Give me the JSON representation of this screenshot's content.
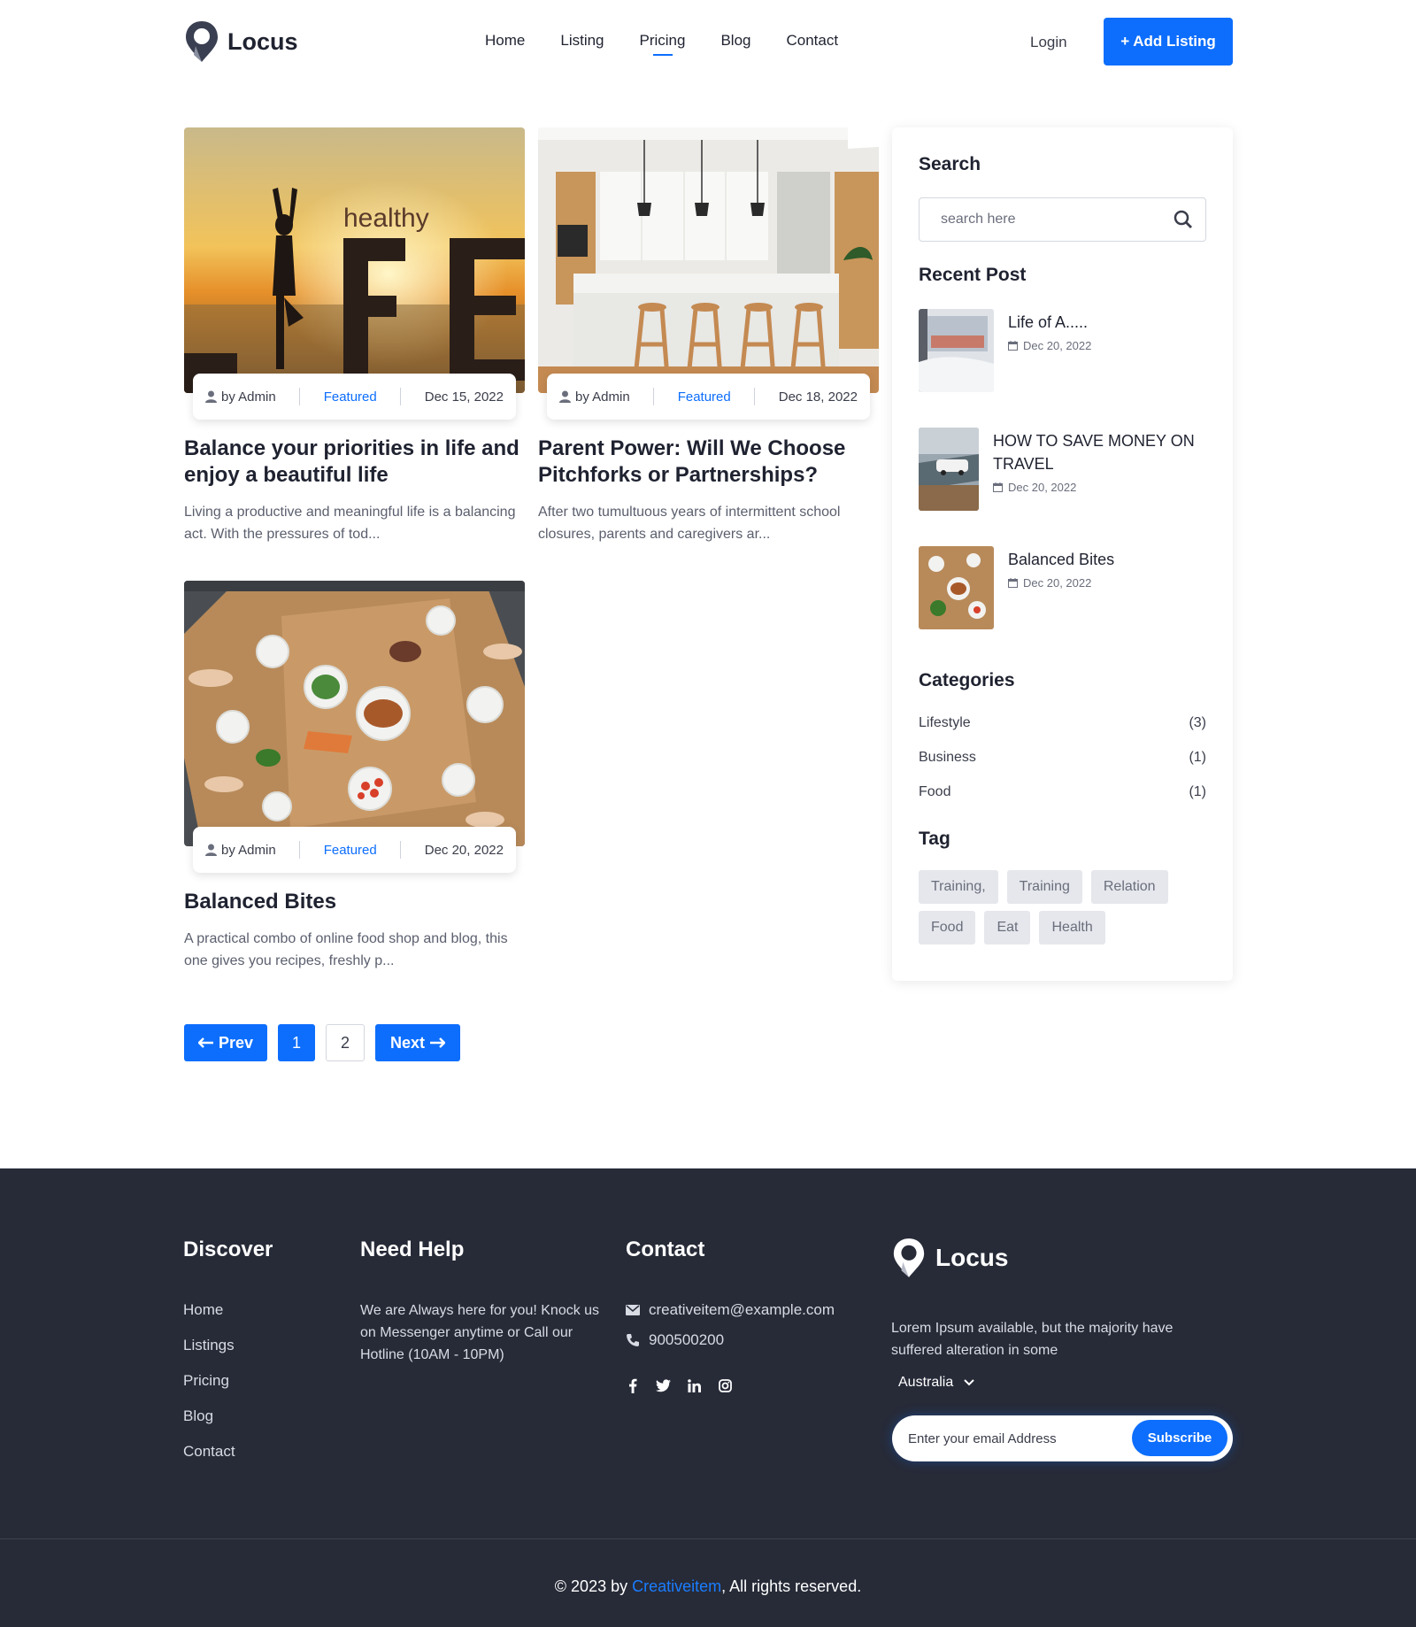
{
  "header": {
    "logo_text": "Locus",
    "nav": [
      {
        "label": "Home",
        "active": false
      },
      {
        "label": "Listing",
        "active": false
      },
      {
        "label": "Pricing",
        "active": true
      },
      {
        "label": "Blog",
        "active": false
      },
      {
        "label": "Contact",
        "active": false
      }
    ],
    "login_label": "Login",
    "add_listing_label": "+ Add Listing",
    "accent_color": "#0d6efd"
  },
  "posts": [
    {
      "author": "by Admin",
      "category": "Featured",
      "date": "Dec 15, 2022",
      "title": "Balance your priorities in life and enjoy a beautiful life",
      "excerpt": "Living a productive and meaningful life is a balancing act. With the pressures of tod...",
      "image_text": "healthy"
    },
    {
      "author": "by Admin",
      "category": "Featured",
      "date": "Dec 18, 2022",
      "title": "Parent Power: Will We Choose Pitchforks or Partnerships?",
      "excerpt": "After two tumultuous years of intermittent school closures, parents and caregivers ar..."
    },
    {
      "author": "by Admin",
      "category": "Featured",
      "date": "Dec 20, 2022",
      "title": "Balanced Bites",
      "excerpt": "A practical combo of online food shop and blog, this one gives you recipes, freshly p..."
    }
  ],
  "pagination": {
    "prev_label": "Prev",
    "pages": [
      "1",
      "2"
    ],
    "current": "1",
    "next_label": "Next"
  },
  "sidebar": {
    "search_heading": "Search",
    "search_placeholder": "search here",
    "recent_heading": "Recent Post",
    "recent_posts": [
      {
        "title": "Life of A.....",
        "date": "Dec 20, 2022"
      },
      {
        "title": "HOW TO SAVE MONEY ON TRAVEL",
        "date": "Dec 20, 2022"
      },
      {
        "title": "Balanced Bites",
        "date": "Dec 20, 2022"
      }
    ],
    "categories_heading": "Categories",
    "categories": [
      {
        "name": "Lifestyle",
        "count": "(3)"
      },
      {
        "name": "Business",
        "count": "(1)"
      },
      {
        "name": "Food",
        "count": "(1)"
      }
    ],
    "tag_heading": "Tag",
    "tags": [
      "Training,",
      "Training",
      "Relation",
      "Food",
      "Eat",
      "Health"
    ]
  },
  "footer": {
    "discover_heading": "Discover",
    "discover_links": [
      "Home",
      "Listings",
      "Pricing",
      "Blog",
      "Contact"
    ],
    "help_heading": "Need Help",
    "help_text": "We are Always here for you! Knock us on Messenger anytime or Call our Hotline (10AM - 10PM)",
    "contact_heading": "Contact",
    "email": "creativeitem@example.com",
    "phone": "900500200",
    "socials": [
      "facebook-icon",
      "twitter-icon",
      "linkedin-icon",
      "instagram-icon"
    ],
    "logo_text": "Locus",
    "about_text": "Lorem Ipsum available, but the majority have suffered alteration in some",
    "country": "Australia",
    "newsletter_placeholder": "Enter your email Address",
    "subscribe_label": "Subscribe",
    "copyright_prefix": "© 2023 by ",
    "copyright_brand": "Creativeitem",
    "copyright_suffix": ", All rights reserved.",
    "background_color": "#272b38"
  }
}
